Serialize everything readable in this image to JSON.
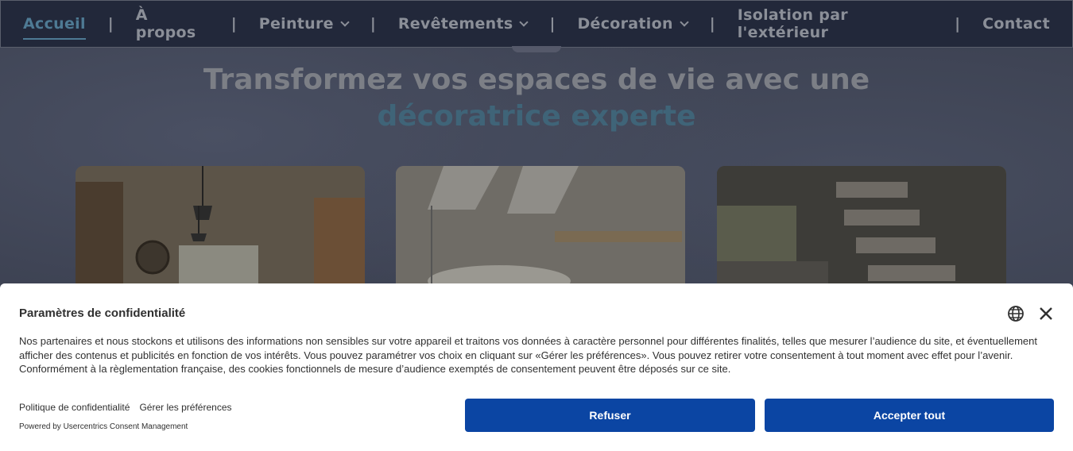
{
  "nav": {
    "items": [
      {
        "label": "Accueil",
        "active": true,
        "has_dropdown": false
      },
      {
        "label": "À propos",
        "active": false,
        "has_dropdown": false
      },
      {
        "label": "Peinture",
        "active": false,
        "has_dropdown": true
      },
      {
        "label": "Revêtements",
        "active": false,
        "has_dropdown": true
      },
      {
        "label": "Décoration",
        "active": false,
        "has_dropdown": true
      },
      {
        "label": "Isolation par l'extérieur",
        "active": false,
        "has_dropdown": false
      },
      {
        "label": "Contact",
        "active": false,
        "has_dropdown": false
      }
    ],
    "separator": "|"
  },
  "hero": {
    "title_line1": "Transformez vos espaces de vie avec une",
    "title_line2": "décoratrice experte"
  },
  "consent": {
    "title": "Paramètres de confidentialité",
    "body": "Nos partenaires et nous stockons et utilisons des informations non sensibles sur votre appareil et traitons vos données à caractère personnel pour différentes finalités, telles que mesurer l’audience du site, et éventuellement afficher des contenus et publicités en fonction de vos intérêts. Vous pouvez paramétrer vos choix en cliquant sur «Gérer les préférences». Vous pouvez retirer votre consentement à tout moment avec effet pour l’avenir. Conformément à la règlementation française, des cookies fonctionnels de mesure d’audience exemptés de consentement peuvent être déposés sur ce site.",
    "link_privacy": "Politique de confidentialité",
    "link_preferences": "Gérer les préférences",
    "powered_by": "Powered by Usercentrics Consent Management",
    "refuse_label": "Refuser",
    "accept_label": "Accepter tout",
    "icons": [
      "globe-icon",
      "close-icon"
    ],
    "button_color": "#0b45a3"
  },
  "colors": {
    "nav_bg": "#22283a",
    "accent": "#4e7a94"
  }
}
